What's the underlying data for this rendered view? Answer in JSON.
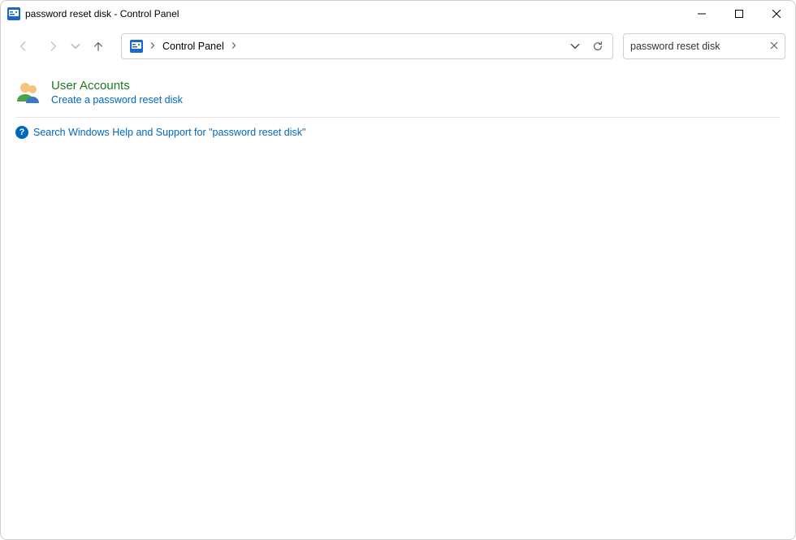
{
  "window": {
    "title": "password reset disk - Control Panel"
  },
  "breadcrumb": {
    "root_label": "Control Panel"
  },
  "search": {
    "value": "password reset disk"
  },
  "results": [
    {
      "category": "User Accounts",
      "link": "Create a password reset disk"
    }
  ],
  "help": {
    "text": "Search Windows Help and Support for \"password reset disk\""
  }
}
